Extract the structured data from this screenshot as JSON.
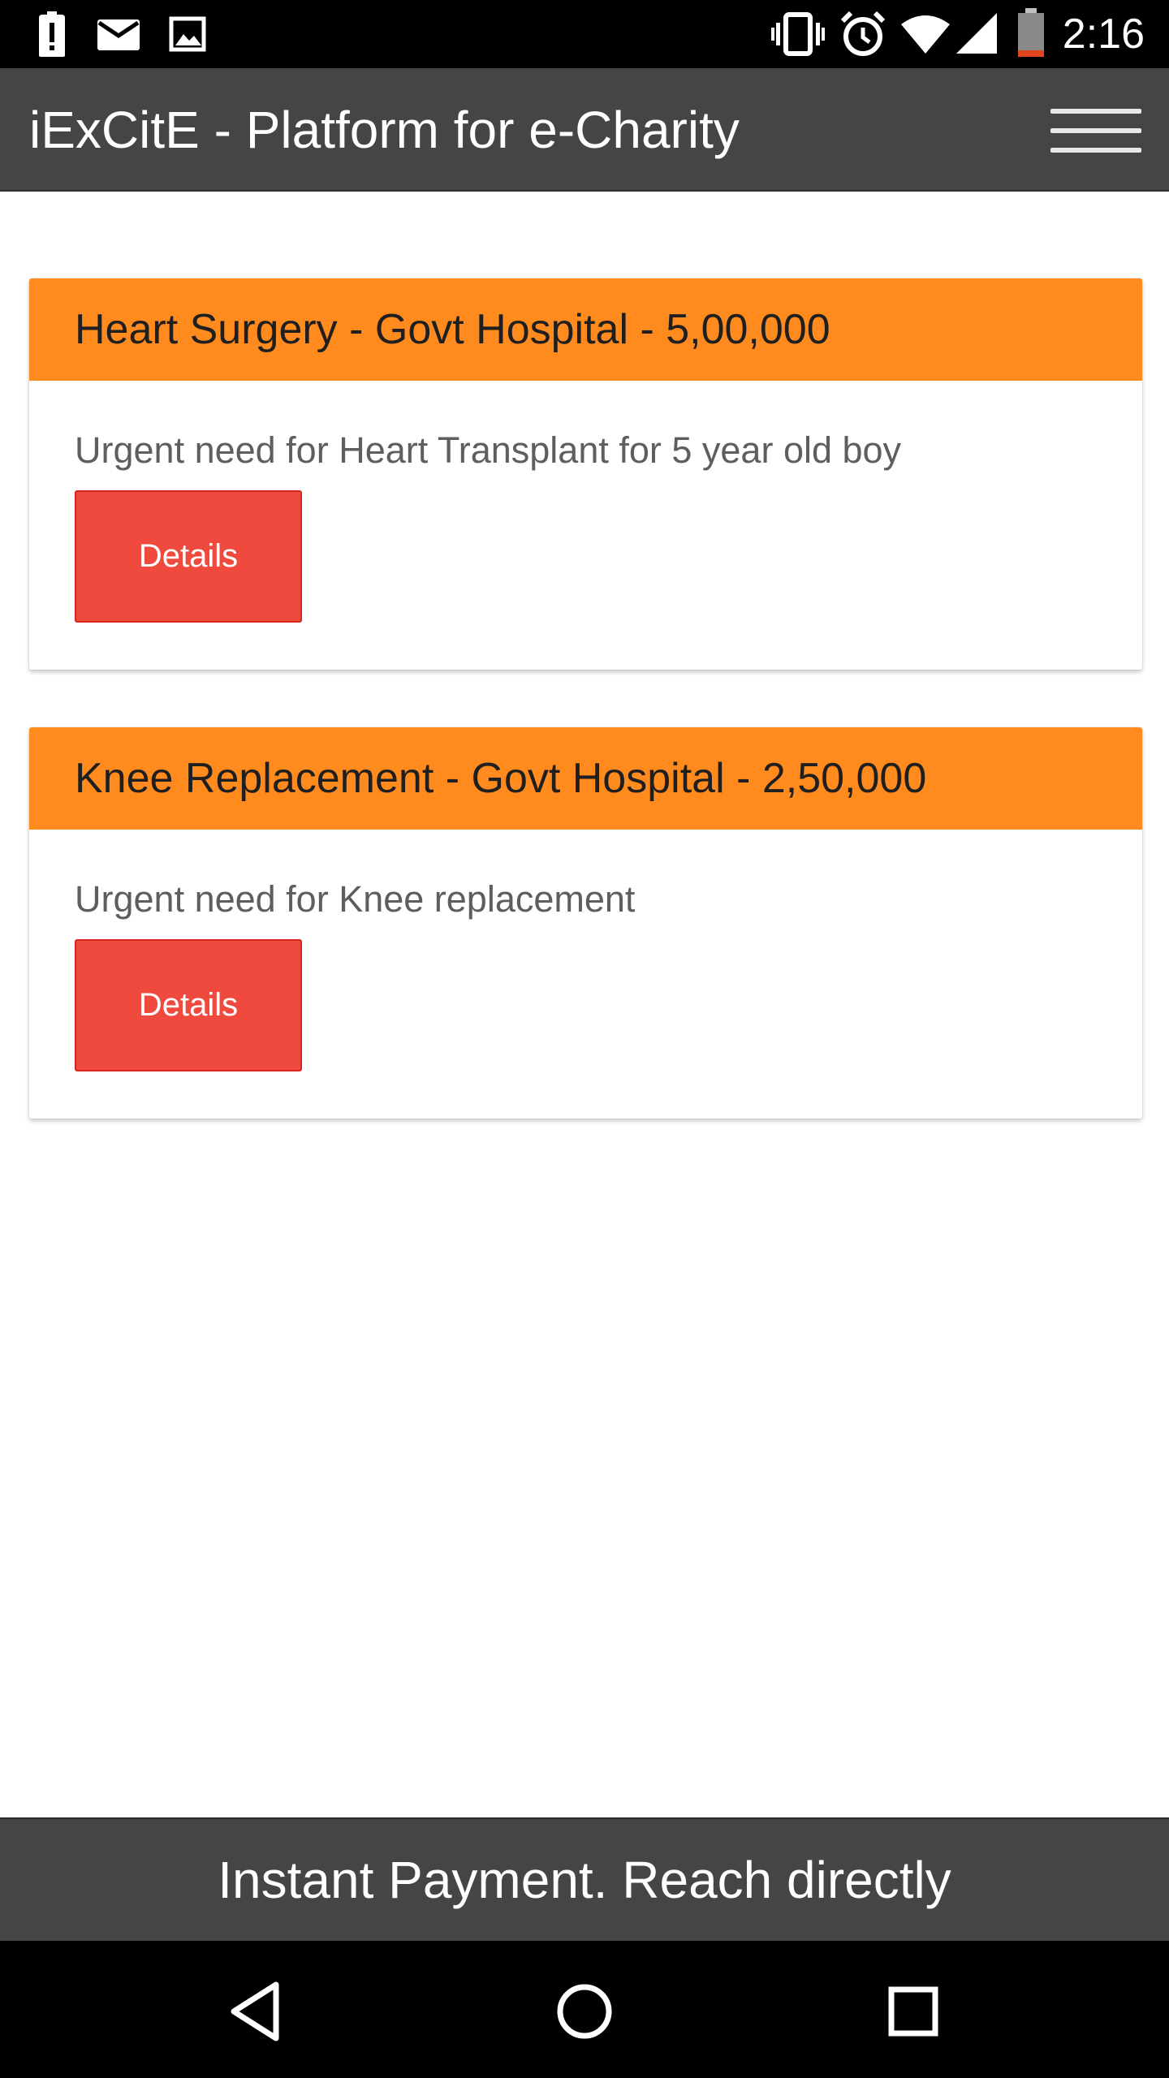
{
  "status_bar": {
    "time": "2:16",
    "left_icons": [
      "alert-icon",
      "mail-icon",
      "image-icon"
    ],
    "right_icons": [
      "vibrate-icon",
      "alarm-icon",
      "wifi-icon",
      "signal-icon",
      "battery-icon"
    ]
  },
  "app_bar": {
    "title": "iExCitE - Platform for e-Charity",
    "menu_icon": "hamburger-menu-icon"
  },
  "cards": [
    {
      "title": "Heart Surgery - Govt Hospital - 5,00,000",
      "description": "Urgent need for Heart Transplant for 5 year old boy",
      "button_label": "Details"
    },
    {
      "title": "Knee Replacement - Govt Hospital - 2,50,000",
      "description": "Urgent need for Knee replacement",
      "button_label": "Details"
    }
  ],
  "footer": {
    "text": "Instant Payment. Reach directly"
  },
  "nav_bar": {
    "icons": [
      "back-icon",
      "home-icon",
      "recents-icon"
    ]
  },
  "colors": {
    "app_bar": "#454545",
    "card_header": "#ff8a1d",
    "button": "#f04a3e",
    "status_bar": "#000000"
  }
}
